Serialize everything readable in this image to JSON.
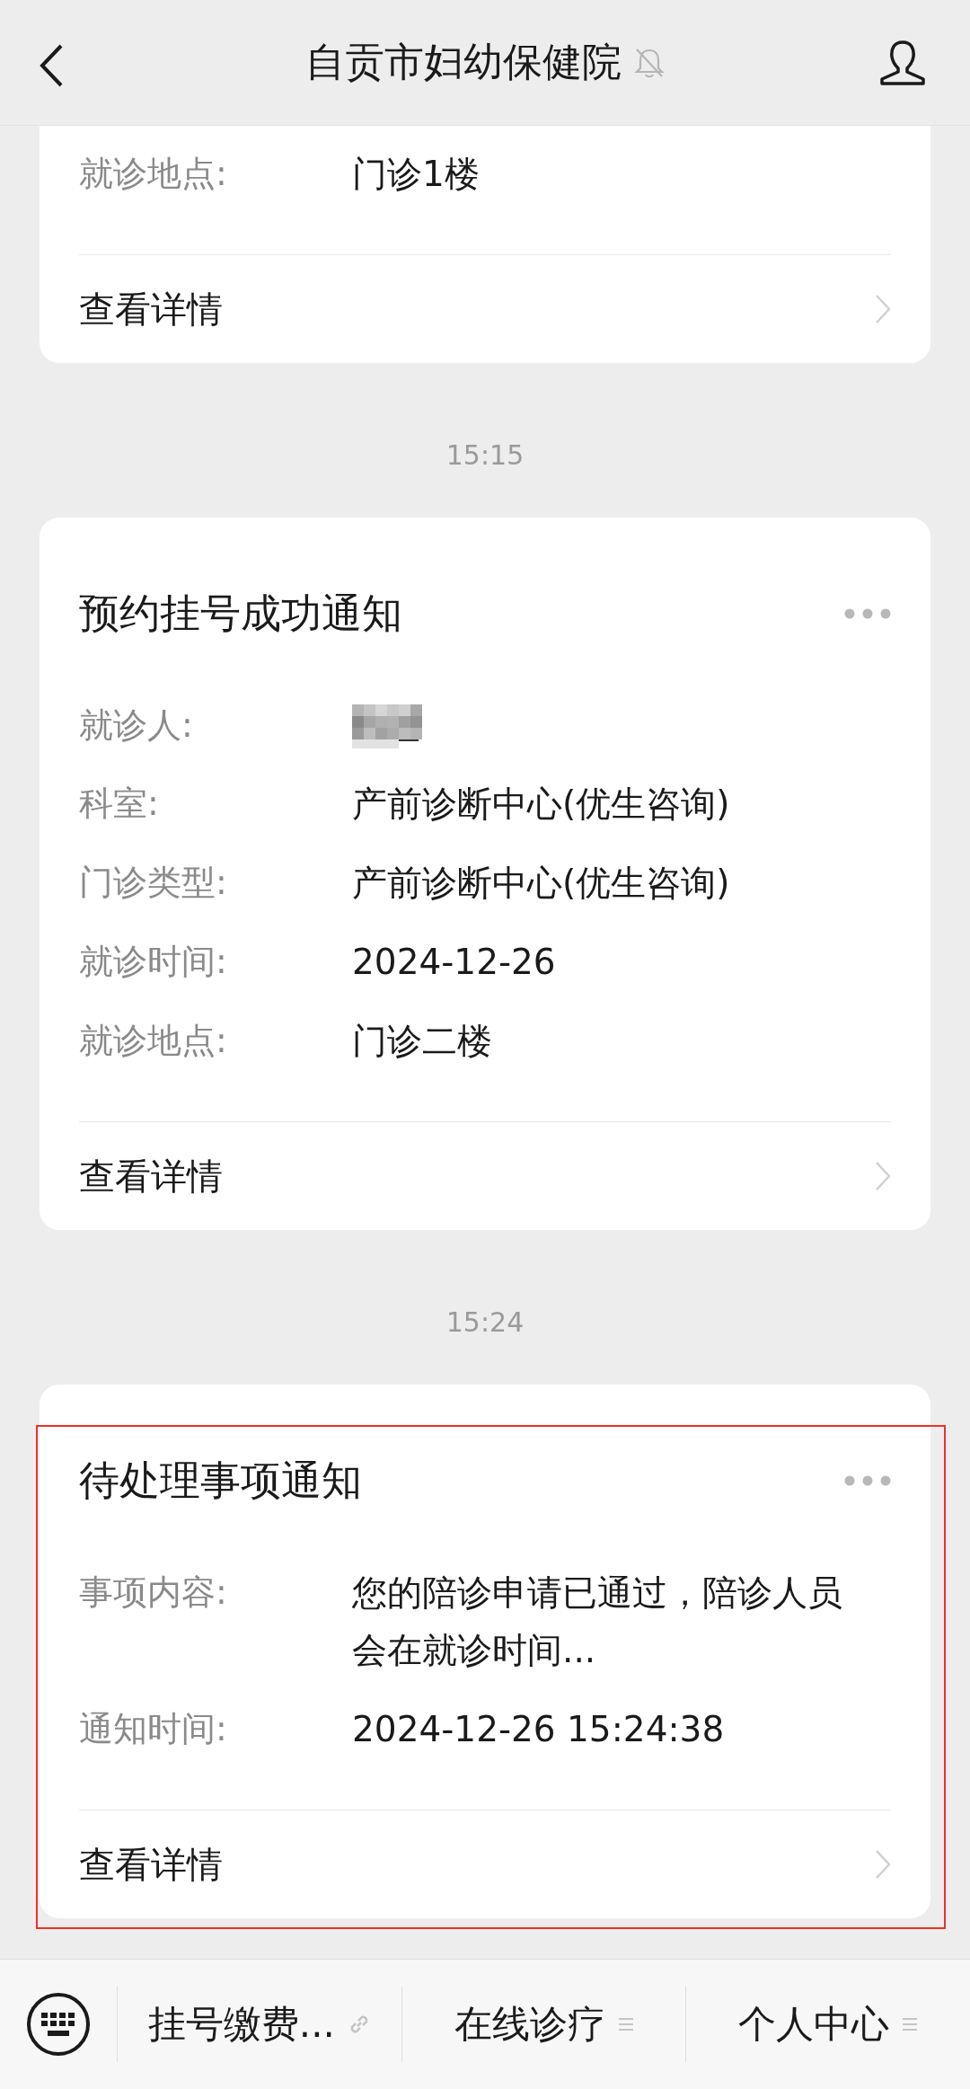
{
  "header": {
    "title": "自贡市妇幼保健院",
    "muted": true
  },
  "messages": [
    {
      "kind": "card",
      "cut_top": true,
      "fields": [
        {
          "label": "就诊地点:",
          "value": "门诊1楼"
        }
      ],
      "link": "查看详情"
    },
    {
      "kind": "time",
      "text": "15:15"
    },
    {
      "kind": "card",
      "title": "预约挂号成功通知",
      "fields": [
        {
          "label": "就诊人:",
          "redacted": true
        },
        {
          "label": "科室:",
          "value": "产前诊断中心(优生咨询)"
        },
        {
          "label": "门诊类型:",
          "value": "产前诊断中心(优生咨询)"
        },
        {
          "label": "就诊时间:",
          "value": "2024-12-26"
        },
        {
          "label": "就诊地点:",
          "value": "门诊二楼"
        }
      ],
      "link": "查看详情"
    },
    {
      "kind": "time",
      "text": "15:24"
    },
    {
      "kind": "card",
      "title": "待处理事项通知",
      "highlighted": true,
      "fields": [
        {
          "label": "事项内容:",
          "value": "您的陪诊申请已通过，陪诊人员会在就诊时间..."
        },
        {
          "label": "通知时间:",
          "value": "2024-12-26 15:24:38"
        }
      ],
      "link": "查看详情"
    }
  ],
  "menu": [
    {
      "label": "挂号缴费...",
      "kind": "link"
    },
    {
      "label": "在线诊疗",
      "kind": "submenu"
    },
    {
      "label": "个人中心",
      "kind": "submenu"
    }
  ]
}
